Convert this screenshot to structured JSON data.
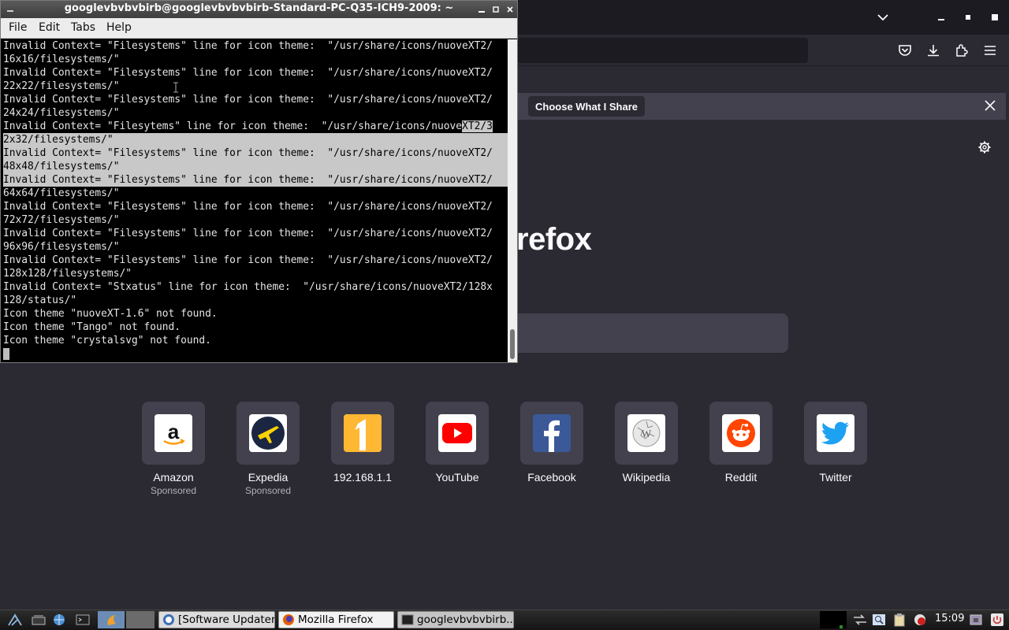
{
  "colors": {
    "firefox_bg": "#2b2a33",
    "firefox_chrome": "#1c1b22",
    "tile_bg": "#42414d",
    "terminal_bg": "#000000",
    "terminal_text": "#e6e6e6",
    "selection": "#c8c8c8"
  },
  "terminal": {
    "title": "googlevbvbvbirb@googlevbvbvbirb-Standard-PC-Q35-ICH9-2009: ~",
    "menu": [
      "File",
      "Edit",
      "Tabs",
      "Help"
    ],
    "lines": [
      "Invalid Context= \"Filesystems\" line for icon theme:  \"/usr/share/icons/nuoveXT2/",
      "16x16/filesystems/\"",
      "Invalid Context= \"Filesystems\" line for icon theme:  \"/usr/share/icons/nuoveXT2/",
      "22x22/filesystems/\"",
      "Invalid Context= \"Filesystems\" line for icon theme:  \"/usr/share/icons/nuoveXT2/",
      "24x24/filesystems/\"",
      "Invalid Context= \"Filesytems\" line for icon theme:  \"/usr/share/icons/nuove",
      "2x32/filesystems/\"",
      "Invalid Context= \"Filesystems\" line for icon theme:  \"/usr/share/icons/nuoveXT2/",
      "48x48/filesystems/\"",
      "Invalid Context= \"Filesystems\" line for icon theme:  \"/usr/share/icons/nuoveXT2/",
      "64x64/filesystems/\"",
      "Invalid Context= \"Filesystems\" line for icon theme:  \"/usr/share/icons/nuoveXT2/",
      "72x72/filesystems/\"",
      "Invalid Context= \"Filesystems\" line for icon theme:  \"/usr/share/icons/nuoveXT2/",
      "96x96/filesystems/\"",
      "Invalid Context= \"Filesystems\" line for icon theme:  \"/usr/share/icons/nuoveXT2/",
      "128x128/filesystems/\"",
      "Invalid Context= \"Stxatus\" line for icon theme:  \"/usr/share/icons/nuoveXT2/128x",
      "128/status/\"",
      "Icon theme \"nuoveXT-1.6\" not found.",
      "Icon theme \"Tango\" not found.",
      "Icon theme \"crystalsvg\" not found."
    ],
    "line7_selected_tail": "XT2/3"
  },
  "firefox": {
    "notification_button": "Choose What I Share",
    "logo_text_visible": "refox",
    "tiles": [
      {
        "label": "Amazon",
        "sub": "Sponsored",
        "icon": "amazon-icon"
      },
      {
        "label": "Expedia",
        "sub": "Sponsored",
        "icon": "expedia-icon"
      },
      {
        "label": "192.168.1.1",
        "sub": "",
        "icon": "numeral-one-icon"
      },
      {
        "label": "YouTube",
        "sub": "",
        "icon": "youtube-icon"
      },
      {
        "label": "Facebook",
        "sub": "",
        "icon": "facebook-icon"
      },
      {
        "label": "Wikipedia",
        "sub": "",
        "icon": "wikipedia-icon"
      },
      {
        "label": "Reddit",
        "sub": "",
        "icon": "reddit-icon"
      },
      {
        "label": "Twitter",
        "sub": "",
        "icon": "twitter-icon"
      }
    ]
  },
  "taskbar": {
    "tasks": [
      "[Software Updater]",
      "Mozilla Firefox",
      "googlevbvbvbirb..."
    ],
    "clock": "15:09"
  }
}
